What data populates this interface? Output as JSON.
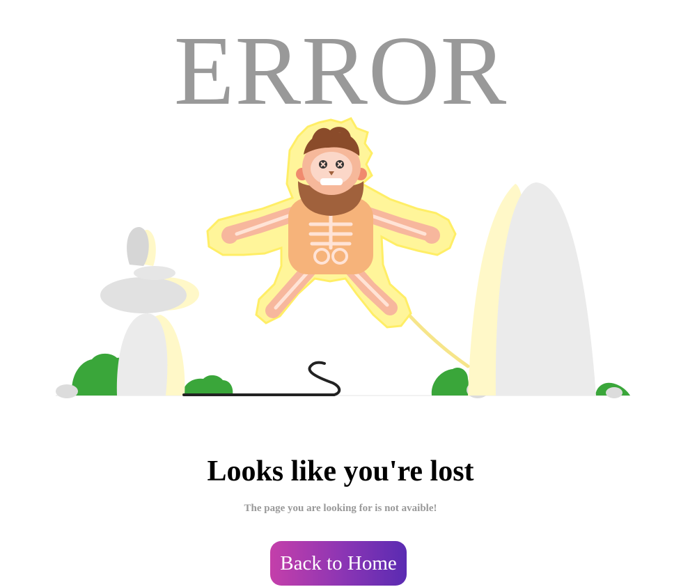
{
  "error_title": "ERROR",
  "illustration": {
    "description_icon": "electrocuted-caveman-illustration"
  },
  "message": {
    "heading": "Looks like you're lost",
    "subtext": "The page you are looking for is not avaible!"
  },
  "button": {
    "label": "Back to Home"
  },
  "colors": {
    "title_gray": "#999999",
    "button_gradient_start": "#c43faa",
    "button_gradient_end": "#5a2bb2",
    "bush_green": "#3aa63a",
    "rock_gray": "#e6e6e6",
    "glow_yellow": "#fff59a"
  }
}
